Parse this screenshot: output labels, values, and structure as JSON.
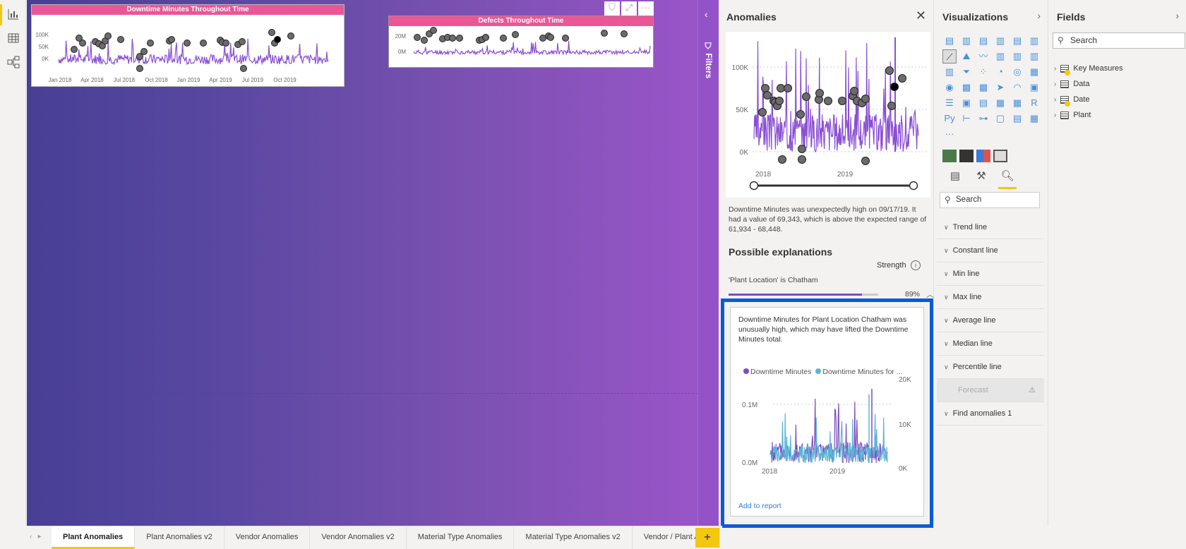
{
  "left_rail": {
    "icons": [
      "report-view-icon",
      "data-view-icon",
      "model-view-icon"
    ]
  },
  "visuals": [
    {
      "title": "Downtime Minutes Throughout Time",
      "y_ticks": [
        "100K",
        "50K",
        "0K"
      ],
      "x_ticks": [
        "Jan 2018",
        "Apr 2018",
        "Jul 2018",
        "Oct 2018",
        "Jan 2019",
        "Apr 2019",
        "Jul 2019",
        "Oct 2019"
      ]
    },
    {
      "title": "Defects Throughout Time",
      "y_ticks": [
        "20M",
        "0M"
      ]
    }
  ],
  "visual_header_buttons": [
    "filter-icon",
    "focus-mode-icon",
    "more-options-icon"
  ],
  "filters_pane": {
    "label": "Filters",
    "collapse": "‹"
  },
  "anomalies_pane": {
    "title": "Anomalies",
    "close": "✕",
    "chart": {
      "y_ticks": [
        "100K",
        "50K",
        "0K"
      ],
      "x_ticks": [
        "2018",
        "2019"
      ]
    },
    "description": "Downtime Minutes was unexpectedly high on 09/17/19. It had a value of 69,343, which is above the expected range of 61,934 - 68,448.",
    "possible_explanations": "Possible explanations",
    "strength_label": "Strength",
    "explanation": {
      "label": "'Plant Location' is Chatham",
      "strength_pct": 89,
      "strength_text": "89%"
    },
    "card": {
      "text": "Downtime Minutes for Plant Location Chatham was unusually high, which may have lifted the Downtime Minutes total.",
      "legend": [
        {
          "label": "Downtime Minutes",
          "color": "#7e4cc0"
        },
        {
          "label": "Downtime Minutes for ...",
          "color": "#5bb6d6"
        }
      ],
      "y_left": [
        "0.1M",
        "0.0M"
      ],
      "y_right": [
        "20K",
        "10K",
        "0K"
      ],
      "x_ticks": [
        "2018",
        "2019"
      ],
      "add_to_report": "Add to report"
    }
  },
  "visualizations_pane": {
    "title": "Visualizations",
    "expand": "›",
    "icons": [
      "▤",
      "▥",
      "▤",
      "▥",
      "▤",
      "▥",
      "⟋",
      "⛰",
      "〰",
      "▥",
      "▥",
      "▥",
      "▥",
      "⏷",
      "⁘",
      "◔",
      "◎",
      "▦",
      "◉",
      "▩",
      "▩",
      "➤",
      "◠",
      "▣",
      "☰",
      "▣",
      "▤",
      "▦",
      "▦",
      "R",
      "Py",
      "⊢",
      "⊶",
      "▢",
      "▤",
      "▦",
      "···"
    ],
    "search_placeholder": "Search",
    "analytics_items": [
      {
        "label": "Trend line"
      },
      {
        "label": "Constant line"
      },
      {
        "label": "Min line"
      },
      {
        "label": "Max line"
      },
      {
        "label": "Average line"
      },
      {
        "label": "Median line"
      },
      {
        "label": "Percentile line"
      },
      {
        "label": "Forecast",
        "disabled": true
      },
      {
        "label": "Find anomalies",
        "count": "1"
      }
    ]
  },
  "fields_pane": {
    "title": "Fields",
    "expand": "›",
    "search_placeholder": "Search",
    "tables": [
      "Key Measures",
      "Data",
      "Date",
      "Plant"
    ]
  },
  "page_tabs": [
    "Plant Anomalies",
    "Plant Anomalies v2",
    "Vendor Anomalies",
    "Vendor Anomalies v2",
    "Material Type Anomalies",
    "Material Type Anomalies v2",
    "Vendor / Plant Ano"
  ],
  "active_tab": 0,
  "add_page": "+",
  "colors": {
    "accent": "#f2c811",
    "series": "#7e4cc0",
    "series2": "#5bb6d6",
    "title_bar": "#ec5596",
    "highlight": "#0b5bd3"
  }
}
